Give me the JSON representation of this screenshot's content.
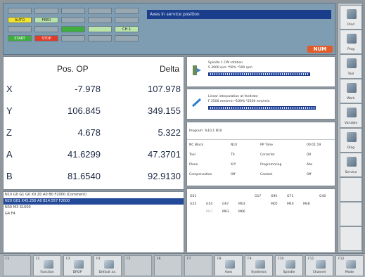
{
  "header": {
    "mode_buttons": [
      {
        "label": "",
        "style": "dim"
      },
      {
        "label": "",
        "style": "dim"
      },
      {
        "label": "",
        "style": "dim"
      },
      {
        "label": "",
        "style": "dim"
      },
      {
        "label": "",
        "style": "dim"
      },
      {
        "label": "AUTO",
        "style": "y"
      },
      {
        "label": "FEED",
        "style": "lg"
      },
      {
        "label": "",
        "style": "dim"
      },
      {
        "label": "",
        "style": "dim"
      },
      {
        "label": "",
        "style": "dim"
      },
      {
        "label": "",
        "style": "dim"
      },
      {
        "label": "",
        "style": "dim"
      },
      {
        "label": "",
        "style": "g"
      },
      {
        "label": "",
        "style": "lg"
      },
      {
        "label": "CH 1",
        "style": "lg"
      },
      {
        "label": "START",
        "style": "g"
      },
      {
        "label": "STOP",
        "style": "r"
      },
      {
        "label": "",
        "style": "dim"
      },
      {
        "label": "",
        "style": "dim"
      },
      {
        "label": "",
        "style": "dim"
      }
    ],
    "alarm_text": "Axes in service position",
    "logo": "NUM"
  },
  "positions": {
    "col_pos": "Pos. OP",
    "col_delta": "Delta",
    "axes": [
      {
        "name": "X",
        "pos": "-7.978",
        "delta": "107.978"
      },
      {
        "name": "Y",
        "pos": "106.845",
        "delta": "349.155"
      },
      {
        "name": "Z",
        "pos": "4.678",
        "delta": "5.322"
      },
      {
        "name": "A",
        "pos": "41.6299",
        "delta": "47.3701"
      },
      {
        "name": "B",
        "pos": "81.6540",
        "delta": "92.9130"
      }
    ]
  },
  "program_lines": [
    {
      "text": "N10 G0 G1 G0 X0 Z0 A0 B0 F2000 (Comment)",
      "selected": false
    },
    {
      "text": "N20 G01 X45.250 A0 B14.557 F2000",
      "selected": true
    },
    {
      "text": "N30 M3 S1000",
      "selected": false
    },
    {
      "text": "G4 F4",
      "selected": false
    }
  ],
  "spindle": {
    "line1": "Spindle 1 CW rotation",
    "line2": "S 3000 rpm  *50% *100 rpm",
    "progress": 0.85
  },
  "interpolation": {
    "line1": "Linear interpolation at feedrate",
    "line2": "F 2500 mm/min *100% *2500 mm/min",
    "progress": 0.9
  },
  "program_info": {
    "program_label": "Program: %10.1 N10",
    "rows": [
      {
        "k1": "NC Block",
        "v1": "N10",
        "k2": "PP Time",
        "v2": "00:01:19"
      },
      {
        "k1": "Tool",
        "v1": "T0",
        "k2": "Corrector",
        "v2": "D0"
      },
      {
        "k1": "Plane",
        "v1": "X/Y",
        "k2": "Programming",
        "v2": "Abs"
      },
      {
        "k1": "Compensation",
        "v1": "Off",
        "k2": "Coolant",
        "v2": "Off"
      }
    ]
  },
  "gcodes": [
    {
      "text": "G01",
      "active": true
    },
    {
      "text": "",
      "active": false
    },
    {
      "text": "",
      "active": false
    },
    {
      "text": "",
      "active": false
    },
    {
      "text": "G17",
      "active": true
    },
    {
      "text": "G90",
      "active": true
    },
    {
      "text": "G71",
      "active": true
    },
    {
      "text": "",
      "active": false
    },
    {
      "text": "G40",
      "active": true
    },
    {
      "text": "G53",
      "active": true
    },
    {
      "text": "G54",
      "active": true
    },
    {
      "text": "G67",
      "active": true
    },
    {
      "text": "M03",
      "active": true
    },
    {
      "text": "",
      "active": false
    },
    {
      "text": "M05",
      "active": true
    },
    {
      "text": "M40",
      "active": true
    },
    {
      "text": "M48",
      "active": true
    },
    {
      "text": "",
      "active": false
    },
    {
      "text": "",
      "active": false
    },
    {
      "text": "M41",
      "active": false
    },
    {
      "text": "M63",
      "active": true
    },
    {
      "text": "M66",
      "active": true
    },
    {
      "text": "",
      "active": false
    },
    {
      "text": "",
      "active": false
    },
    {
      "text": "",
      "active": false
    }
  ],
  "side_keys": [
    {
      "label": "Prod"
    },
    {
      "label": "Prog"
    },
    {
      "label": "Tool"
    },
    {
      "label": "Work"
    },
    {
      "label": "Variable"
    },
    {
      "label": "Diag"
    },
    {
      "label": "Service"
    },
    {
      "label": ""
    },
    {
      "label": ""
    },
    {
      "label": ""
    }
  ],
  "bottom_keys": [
    {
      "num": "F1",
      "label": ""
    },
    {
      "num": "F2",
      "label": "Function"
    },
    {
      "num": "F3",
      "label": "DROP"
    },
    {
      "num": "F4",
      "label": "Default ax."
    },
    {
      "num": "F5",
      "label": ""
    },
    {
      "num": "F6",
      "label": ""
    },
    {
      "num": "F7",
      "label": ""
    },
    {
      "num": "F8",
      "label": "Axes"
    },
    {
      "num": "F9",
      "label": "Synthesis"
    },
    {
      "num": "F10",
      "label": "Spindle"
    },
    {
      "num": "F11",
      "label": "Channel"
    },
    {
      "num": "F12",
      "label": "Mode"
    }
  ]
}
